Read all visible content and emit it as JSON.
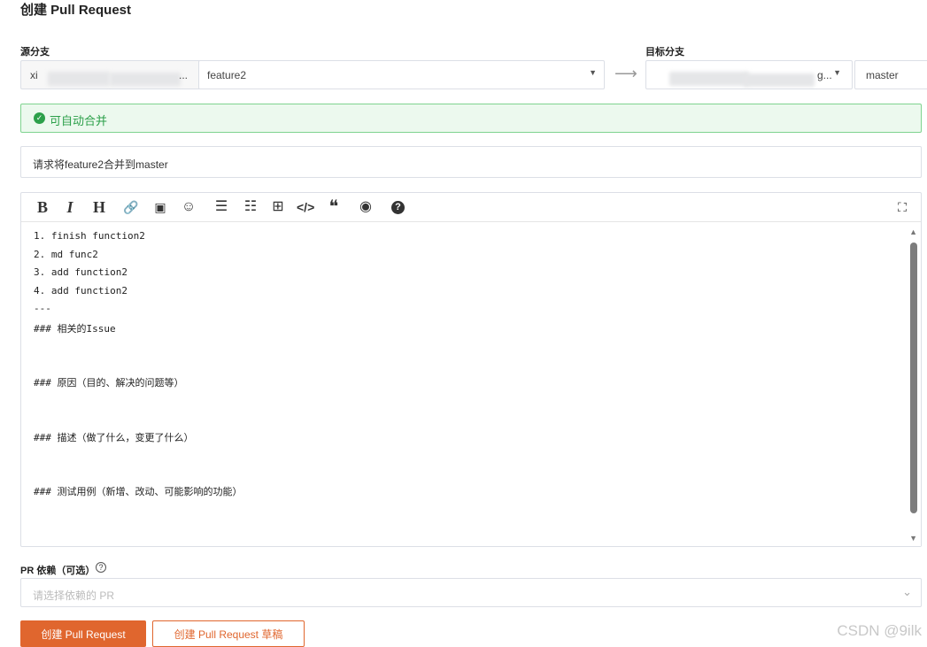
{
  "page": {
    "title": "创建 Pull Request"
  },
  "source": {
    "label": "源分支",
    "owner_text": "xi",
    "owner_ellipsis": "...",
    "branch": "feature2"
  },
  "target": {
    "label": "目标分支",
    "owner_text": "g...",
    "branch": "master"
  },
  "merge_status": {
    "text": "可自动合并",
    "color": "#2ca04a"
  },
  "pr_title": {
    "value": "请求将feature2合并到master"
  },
  "editor": {
    "toolbar": [
      {
        "name": "bold-icon",
        "glyph": "B"
      },
      {
        "name": "italic-icon",
        "glyph": "I"
      },
      {
        "name": "heading-icon",
        "glyph": "H"
      },
      {
        "name": "link-icon",
        "glyph": "🔗"
      },
      {
        "name": "image-icon",
        "glyph": "▣"
      },
      {
        "name": "emoji-icon",
        "glyph": "☺"
      },
      {
        "name": "unordered-list-icon",
        "glyph": "☰"
      },
      {
        "name": "ordered-list-icon",
        "glyph": "☷"
      },
      {
        "name": "table-icon",
        "glyph": "⊞"
      },
      {
        "name": "code-icon",
        "glyph": "</>"
      },
      {
        "name": "quote-icon",
        "glyph": "❝"
      },
      {
        "name": "preview-icon",
        "glyph": "◉"
      },
      {
        "name": "help-icon",
        "glyph": "?"
      }
    ],
    "fullscreen_glyph": "⛶",
    "lines": [
      "1. finish function2",
      "2. md func2",
      "3. add function2",
      "4. add function2",
      "---",
      "### 相关的Issue",
      "",
      "",
      "### 原因（目的、解决的问题等）",
      "",
      "",
      "### 描述（做了什么，变更了什么）",
      "",
      "",
      "### 测试用例（新增、改动、可能影响的功能）"
    ]
  },
  "dependency": {
    "label": "PR 依赖（可选）",
    "placeholder": "请选择依赖的 PR"
  },
  "buttons": {
    "create": "创建 Pull Request",
    "create_draft": "创建 Pull Request 草稿"
  },
  "watermark": "CSDN @9ilk",
  "colors": {
    "accent": "#e0662e",
    "success": "#2ca04a"
  }
}
